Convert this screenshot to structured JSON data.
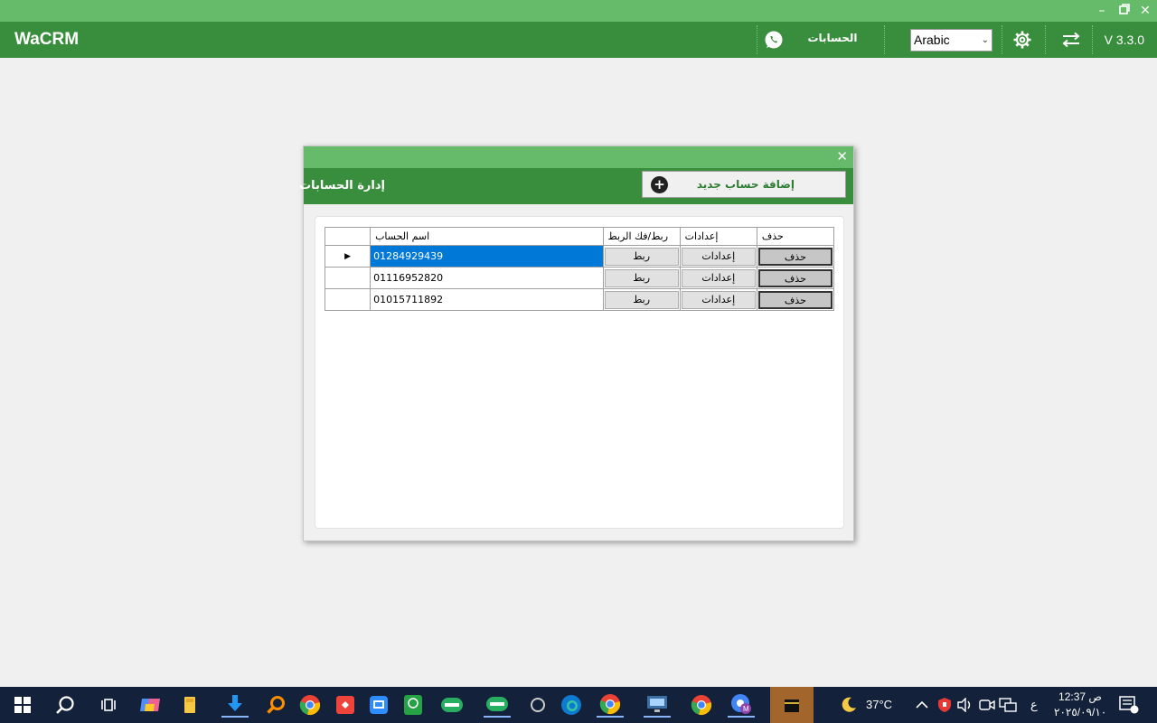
{
  "app": {
    "title": "WaCRM",
    "version": "V 3.3.0"
  },
  "header": {
    "accounts_label": "الحسابات",
    "language": "Arabic"
  },
  "dialog": {
    "title": "إدارة الحسابات",
    "add_button_label": "إضافة حساب جديد",
    "columns": {
      "name": "اسم الحساب",
      "link": "ربط/فك الربط",
      "settings": "إعدادات",
      "delete": "حذف"
    },
    "rows": [
      {
        "name": "01284929439",
        "link": "ربط",
        "settings": "إعدادات",
        "delete": "حذف"
      },
      {
        "name": "01116952820",
        "link": "ربط",
        "settings": "إعدادات",
        "delete": "حذف"
      },
      {
        "name": "01015711892",
        "link": "ربط",
        "settings": "إعدادات",
        "delete": "حذف"
      }
    ]
  },
  "taskbar": {
    "weather": "37°C",
    "time": "12:37 ص",
    "date": "٢٠٢٥/٠٩/١٠",
    "ime": "ع"
  },
  "colors": {
    "header": "#388e3c",
    "strip": "#66bb6a",
    "selection": "#0078d7"
  }
}
